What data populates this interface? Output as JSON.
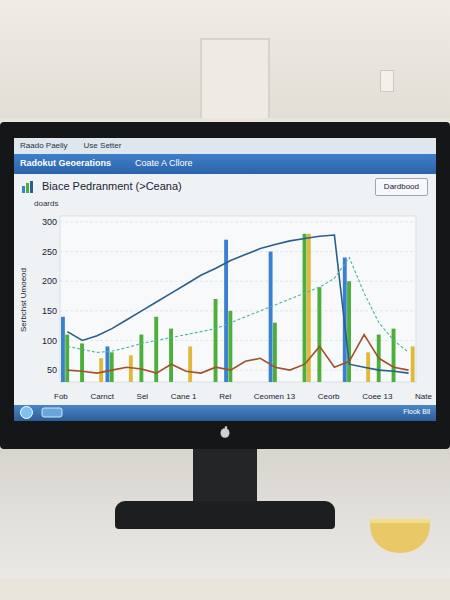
{
  "window": {
    "title": "Raado Paelly",
    "menu": [
      "Use Setter"
    ]
  },
  "app_bar": {
    "title": "Radokut Geoerations",
    "subtitle": "Coate A Cllore"
  },
  "chart": {
    "title": "Biace Pedranment (>Ceana)",
    "button": "Dardbood",
    "subtitle": "doards",
    "y_axis": {
      "label": "Serbchst Umoeod",
      "ticks": [
        "300",
        "250",
        "200",
        "150",
        "100",
        "50"
      ]
    },
    "x_axis": {
      "labels": [
        "Fob",
        "Carnct",
        "Sel",
        "Cane 1",
        "Rel",
        "Ceomen 13",
        "Ceorb",
        "Coee 13",
        "Nate"
      ]
    },
    "series": [
      {
        "kind": "bar",
        "color": "#3a7fd0",
        "values": [
          140,
          0,
          0,
          90,
          0,
          0,
          0,
          0,
          0,
          0,
          0,
          270,
          0,
          0,
          250,
          0,
          0,
          0,
          0,
          240,
          0,
          0,
          0,
          0
        ]
      },
      {
        "kind": "bar",
        "color": "#4caf3a",
        "values": [
          110,
          95,
          0,
          80,
          0,
          110,
          140,
          120,
          0,
          0,
          170,
          150,
          0,
          0,
          130,
          0,
          280,
          190,
          0,
          200,
          0,
          110,
          120,
          0
        ]
      },
      {
        "kind": "bar",
        "color": "#e0b83a",
        "values": [
          0,
          0,
          70,
          0,
          75,
          0,
          0,
          0,
          90,
          0,
          0,
          0,
          0,
          0,
          0,
          0,
          280,
          0,
          0,
          0,
          80,
          0,
          0,
          90
        ]
      },
      {
        "kind": "line",
        "color": "#2a5f8a",
        "values": [
          115,
          100,
          108,
          120,
          135,
          150,
          165,
          180,
          195,
          210,
          222,
          235,
          245,
          255,
          262,
          268,
          272,
          276,
          278,
          60,
          55,
          50,
          48,
          45
        ]
      },
      {
        "kind": "dashed-line",
        "color": "#4fb3a6",
        "values": [
          90,
          85,
          80,
          82,
          88,
          95,
          100,
          105,
          110,
          115,
          120,
          130,
          140,
          150,
          160,
          170,
          180,
          190,
          205,
          240,
          180,
          130,
          100,
          80
        ]
      },
      {
        "kind": "line",
        "color": "#a0522d",
        "values": [
          50,
          48,
          45,
          50,
          55,
          52,
          45,
          60,
          48,
          45,
          55,
          50,
          65,
          70,
          55,
          50,
          60,
          90,
          55,
          65,
          110,
          70,
          55,
          50
        ]
      }
    ]
  },
  "taskbar": {
    "status": "Flook Bll"
  }
}
